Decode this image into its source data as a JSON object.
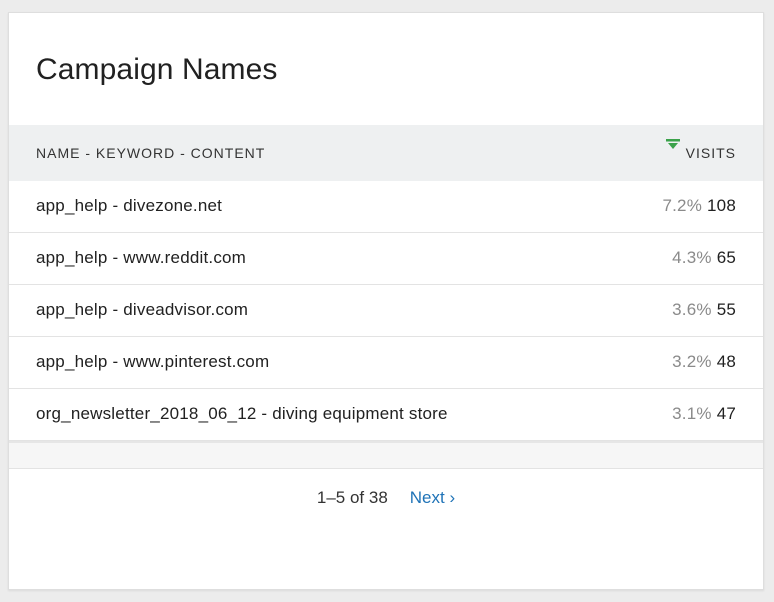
{
  "widget": {
    "title": "Campaign Names"
  },
  "table": {
    "columns": {
      "name": "NAME - KEYWORD - CONTENT",
      "visits": "VISITS"
    },
    "sort": {
      "column": "visits",
      "direction": "descending",
      "icon": "sort-descending-icon",
      "color": "#3aa24a"
    },
    "rows": [
      {
        "name": "app_help - divezone.net",
        "percent": "7.2%",
        "visits": "108"
      },
      {
        "name": "app_help - www.reddit.com",
        "percent": "4.3%",
        "visits": "65"
      },
      {
        "name": "app_help - diveadvisor.com",
        "percent": "3.6%",
        "visits": "55"
      },
      {
        "name": "app_help - www.pinterest.com",
        "percent": "3.2%",
        "visits": "48"
      },
      {
        "name": "org_newsletter_2018_06_12 - diving equipment store",
        "percent": "3.1%",
        "visits": "47"
      }
    ]
  },
  "pagination": {
    "range": "1–5 of 38",
    "next_label": "Next ›",
    "link_color": "#1f73b7"
  }
}
